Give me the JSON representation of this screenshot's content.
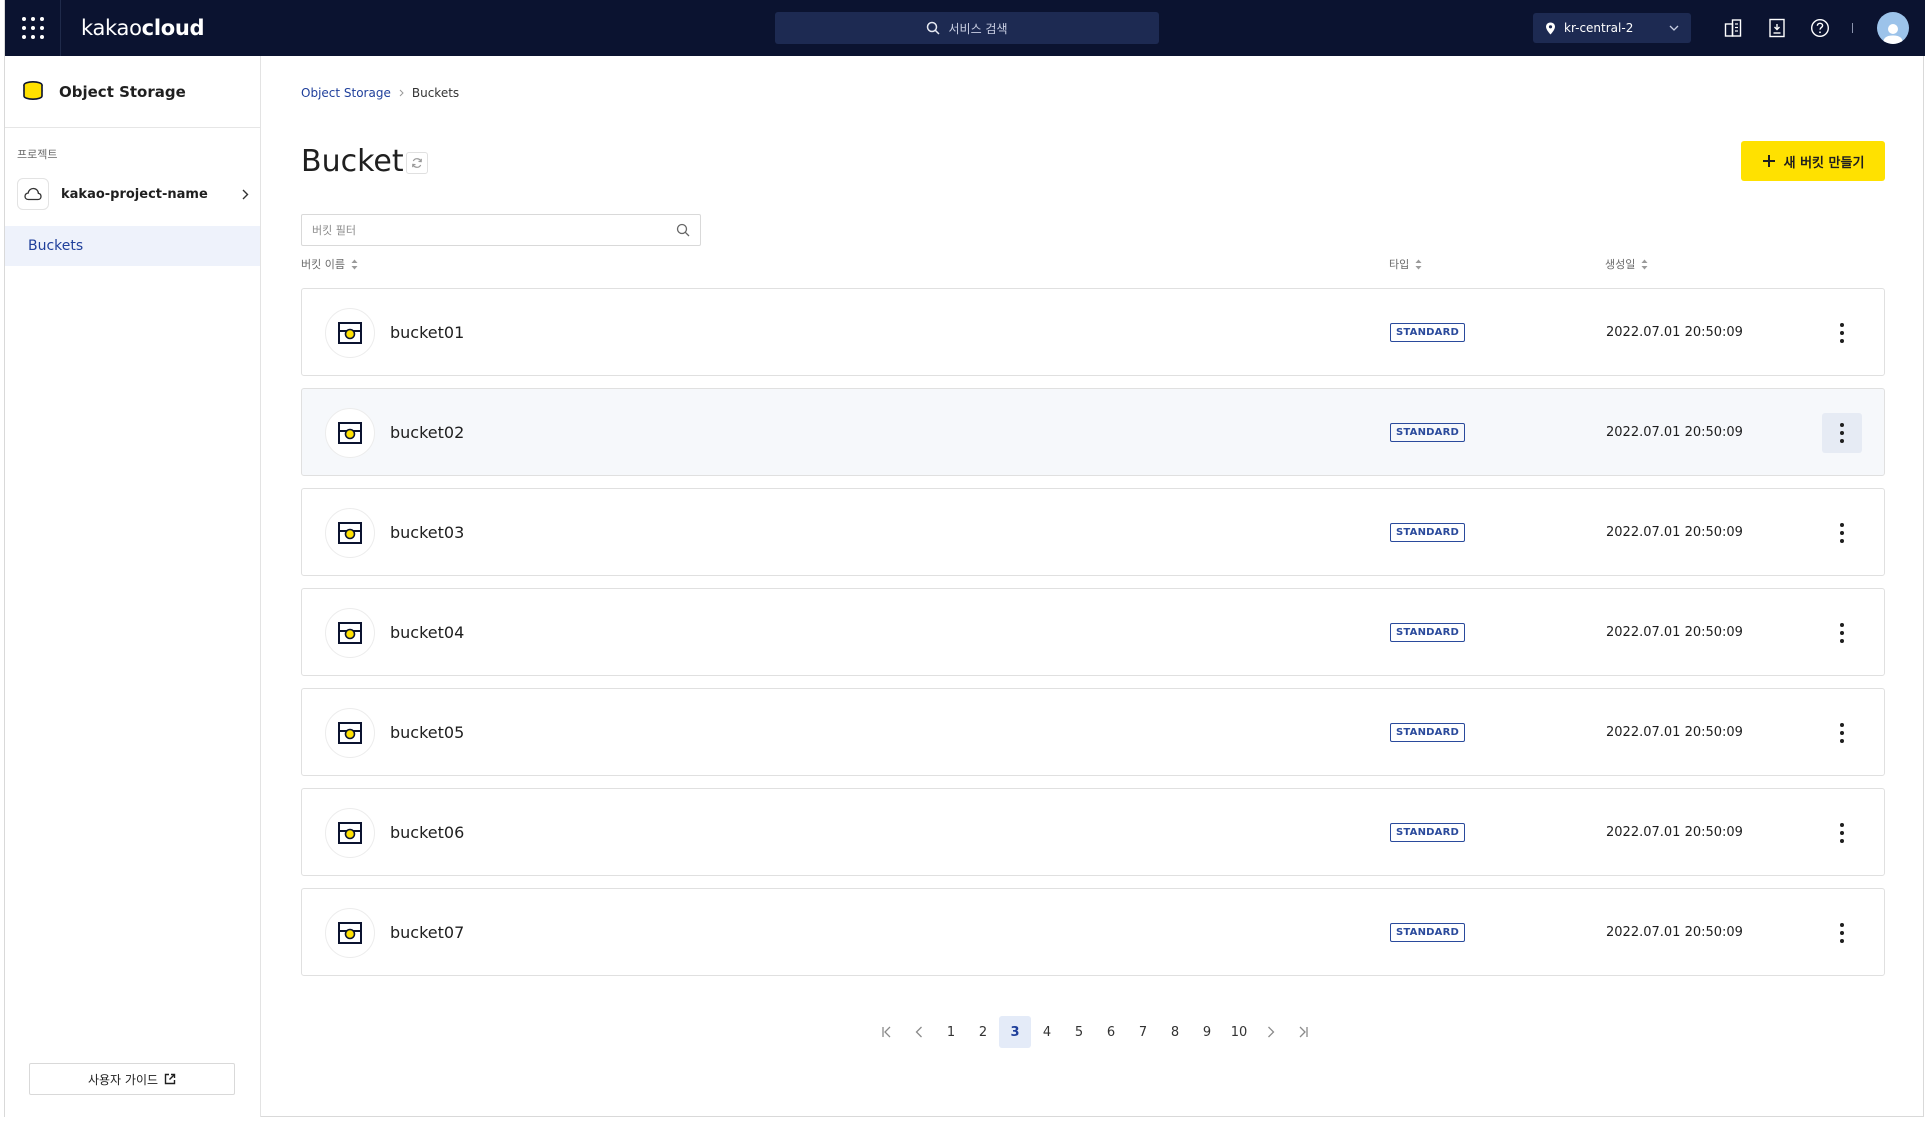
{
  "topbar": {
    "logo_light": "kakao",
    "logo_bold": "cloud",
    "search_placeholder": "서비스 검색",
    "region": "kr-central-2"
  },
  "sidebar": {
    "title": "Object Storage",
    "project_label": "프로젝트",
    "project_name": "kakao-project-name",
    "active_item": "Buckets",
    "guide_label": "사용자 가이드"
  },
  "breadcrumb": {
    "parent": "Object Storage",
    "current": "Buckets"
  },
  "page": {
    "title": "Bucket",
    "create_label": "새 버킷 만들기",
    "filter_placeholder": "버킷 필터"
  },
  "table": {
    "columns": {
      "name": "버킷 이름",
      "type": "타입",
      "created": "생성일"
    },
    "rows": [
      {
        "name": "bucket01",
        "type": "STANDARD",
        "created": "2022.07.01 20:50:09"
      },
      {
        "name": "bucket02",
        "type": "STANDARD",
        "created": "2022.07.01 20:50:09"
      },
      {
        "name": "bucket03",
        "type": "STANDARD",
        "created": "2022.07.01 20:50:09"
      },
      {
        "name": "bucket04",
        "type": "STANDARD",
        "created": "2022.07.01 20:50:09"
      },
      {
        "name": "bucket05",
        "type": "STANDARD",
        "created": "2022.07.01 20:50:09"
      },
      {
        "name": "bucket06",
        "type": "STANDARD",
        "created": "2022.07.01 20:50:09"
      },
      {
        "name": "bucket07",
        "type": "STANDARD",
        "created": "2022.07.01 20:50:09"
      }
    ]
  },
  "pagination": {
    "pages": [
      "1",
      "2",
      "3",
      "4",
      "5",
      "6",
      "7",
      "8",
      "9",
      "10"
    ],
    "current": "3"
  },
  "colors": {
    "topbar_bg": "#0b1330",
    "accent_yellow": "#ffe100",
    "accent_blue": "#1f3f9b"
  },
  "icons": [
    "apps-grid-icon",
    "search-icon",
    "location-pin-icon",
    "chevron-down-icon",
    "building-icon",
    "document-icon",
    "help-icon",
    "user-avatar-icon",
    "database-icon",
    "cloud-icon",
    "chevron-right-icon",
    "external-link-icon",
    "refresh-icon",
    "plus-icon",
    "sort-icon",
    "bucket-icon",
    "more-vertical-icon",
    "first-page-icon",
    "prev-page-icon",
    "next-page-icon",
    "last-page-icon"
  ]
}
